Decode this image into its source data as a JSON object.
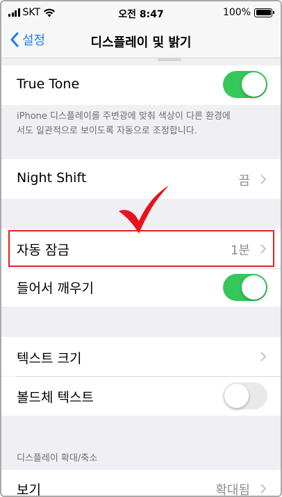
{
  "status_bar": {
    "carrier": "SKT",
    "time": "오전 8:47",
    "battery": "100%"
  },
  "nav": {
    "back_label": "설정",
    "title": "디스플레이 및 밝기"
  },
  "true_tone": {
    "label": "True Tone",
    "enabled": true,
    "footnote_line1": "iPhone 디스플레이를 주변광에 맞춰 색상이 다른 환경에",
    "footnote_line2": "서도 일관적으로 보이도록 자동으로 조정합니다."
  },
  "night_shift": {
    "label": "Night Shift",
    "value": "끔"
  },
  "auto_lock": {
    "label": "자동 잠금",
    "value": "1분"
  },
  "raise_to_wake": {
    "label": "들어서 깨우기",
    "enabled": true
  },
  "text_size": {
    "label": "텍스트 크기"
  },
  "bold_text": {
    "label": "볼드체 텍스트",
    "enabled": false
  },
  "zoom_section": {
    "header": "디스플레이 확대/축소",
    "view_label": "보기",
    "view_value": "확대됨"
  },
  "colors": {
    "accent": "#1a7cf5",
    "toggle_on": "#34c759",
    "highlight": "#e02020"
  }
}
